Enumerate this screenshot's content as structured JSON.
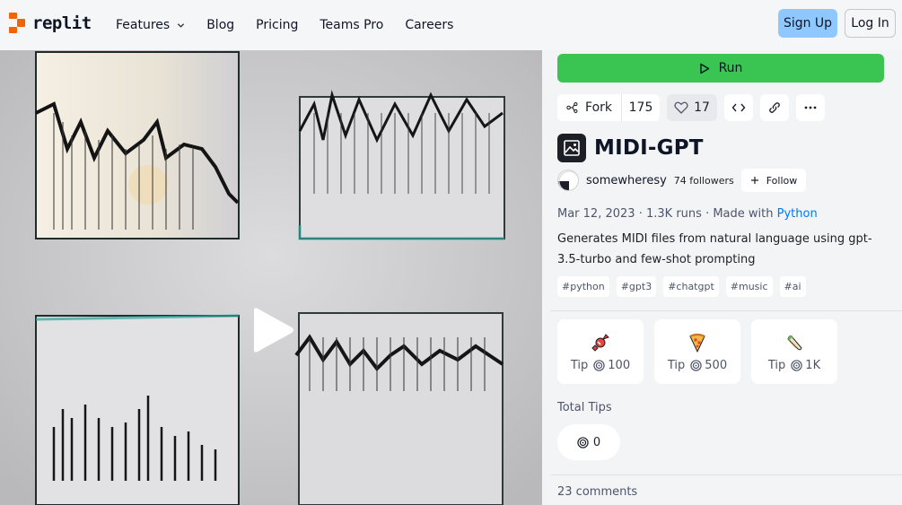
{
  "header": {
    "logo_text": "replit",
    "nav": [
      {
        "label": "Features",
        "has_dropdown": true
      },
      {
        "label": "Blog"
      },
      {
        "label": "Pricing"
      },
      {
        "label": "Teams Pro"
      },
      {
        "label": "Careers"
      }
    ],
    "signup_label": "Sign Up",
    "login_label": "Log In"
  },
  "repl": {
    "run_label": "Run",
    "fork_label": "Fork",
    "fork_count": "175",
    "like_count": "17",
    "title": "MIDI-GPT",
    "author": {
      "username": "somewheresy",
      "followers": "74 followers",
      "follow_label": "Follow"
    },
    "meta": {
      "date": "Mar 12, 2023",
      "sep1": "·",
      "runs": "1.3K runs",
      "sep2": "·",
      "made_with_prefix": "Made with",
      "language": "Python"
    },
    "description": "Generates MIDI files from natural language using gpt-3.5-turbo and few-shot prompting",
    "tags": [
      "#python",
      "#gpt3",
      "#chatgpt",
      "#music",
      "#ai"
    ]
  },
  "tips": {
    "options": [
      {
        "label": "Tip",
        "amount": "100",
        "icon": "candy-icon"
      },
      {
        "label": "Tip",
        "amount": "500",
        "icon": "pizza-icon"
      },
      {
        "label": "Tip",
        "amount": "1K",
        "icon": "burrito-icon"
      }
    ],
    "total_label": "Total Tips",
    "total_value": "0"
  },
  "comments_label": "23 comments",
  "colors": {
    "run_green": "#3ac451",
    "signup_blue": "#8fc7ff",
    "brand_orange": "#f26207",
    "link_blue": "#0079f2"
  }
}
